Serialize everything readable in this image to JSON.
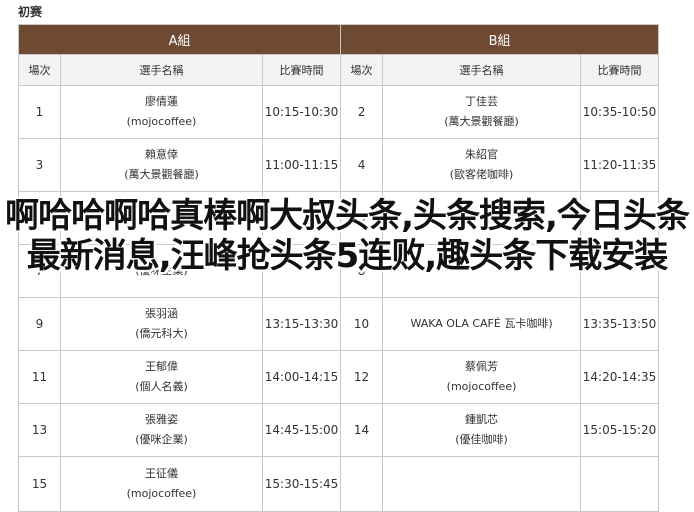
{
  "page_title": "初赛",
  "groups": {
    "a": "A組",
    "b": "B組"
  },
  "columns": {
    "order": "場次",
    "player": "選手名稱",
    "time": "比賽時間"
  },
  "rows": [
    {
      "a": {
        "no": "1",
        "name": "廖倩蓮",
        "team": "(mojocoffee)",
        "time": "10:15-10:30"
      },
      "b": {
        "no": "2",
        "name": "丁佳芸",
        "team": "(萬大景觀餐廳)",
        "time": "10:35-10:50"
      }
    },
    {
      "a": {
        "no": "3",
        "name": "賴意倖",
        "team": "(萬大景觀餐廳)",
        "time": "11:00-11:15"
      },
      "b": {
        "no": "4",
        "name": "朱紹官",
        "team": "(歐客佬咖啡)",
        "time": "11:20-11:35"
      }
    },
    {
      "a": {
        "no": "5",
        "name": "",
        "team": "",
        "time": ""
      },
      "b": {
        "no": "6",
        "name": "",
        "team": "",
        "time": ""
      }
    },
    {
      "a": {
        "no": "7",
        "name": "",
        "team": "(優咪企業)",
        "time": ""
      },
      "b": {
        "no": "8",
        "name": "",
        "team": "",
        "time": ""
      }
    },
    {
      "a": {
        "no": "9",
        "name": "張羽涵",
        "team": "(僑元科大)",
        "time": "13:15-13:30"
      },
      "b": {
        "no": "10",
        "name": "",
        "team": "WAKA OLA CAFÉ 瓦卡咖啡)",
        "time": "13:35-13:50"
      }
    },
    {
      "a": {
        "no": "11",
        "name": "王郁偉",
        "team": "(個人名義)",
        "time": "14:00-14:15"
      },
      "b": {
        "no": "12",
        "name": "蔡佩芳",
        "team": "(mojocoffee)",
        "time": "14:20-14:35"
      }
    },
    {
      "a": {
        "no": "13",
        "name": "張雅姿",
        "team": "(優咪企業)",
        "time": "14:45-15:00"
      },
      "b": {
        "no": "14",
        "name": "鍾凱芯",
        "team": "(優佳咖啡)",
        "time": "15:05-15:20"
      }
    },
    {
      "a": {
        "no": "15",
        "name": "王征儀",
        "team": "(mojocoffee)",
        "time": "15:30-15:45"
      },
      "b": {
        "no": "",
        "name": "",
        "team": "",
        "time": ""
      }
    }
  ],
  "overlay_text": "啊哈哈啊哈真棒啊大叔头条,头条搜索,今日头条最新消息,汪峰抢头条5连败,趣头条下载安装"
}
